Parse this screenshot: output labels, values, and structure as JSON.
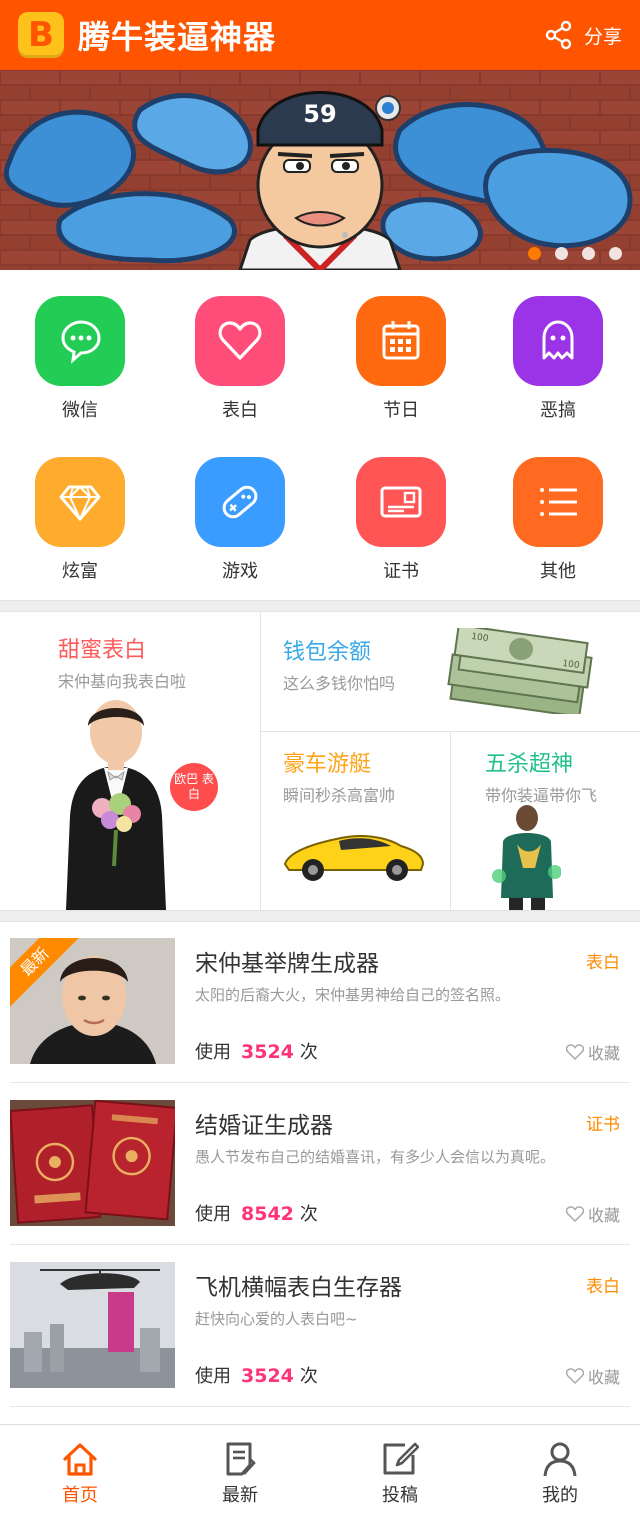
{
  "header": {
    "logo": "B",
    "title": "腾牛装逼神器",
    "share_label": "分享",
    "bg_color": "#ff5500"
  },
  "banner": {
    "slide_count": 4,
    "active_slide": 1,
    "cap_text": "59"
  },
  "categories": [
    {
      "label": "微信",
      "icon": "chat-icon",
      "color": "#22cc55"
    },
    {
      "label": "表白",
      "icon": "heart-icon",
      "color": "#ff4d7a"
    },
    {
      "label": "节日",
      "icon": "calendar-icon",
      "color": "#ff6a10"
    },
    {
      "label": "恶搞",
      "icon": "ghost-icon",
      "color": "#9b33e6"
    },
    {
      "label": "炫富",
      "icon": "diamond-icon",
      "color": "#ffab2e"
    },
    {
      "label": "游戏",
      "icon": "gamepad-icon",
      "color": "#3a9cff"
    },
    {
      "label": "证书",
      "icon": "certificate-icon",
      "color": "#ff5555"
    },
    {
      "label": "其他",
      "icon": "list-icon",
      "color": "#ff6a20"
    }
  ],
  "features": {
    "sweet": {
      "title": "甜蜜表白",
      "subtitle": "宋仲基向我表白啦",
      "badge": "欧巴 表白",
      "color": "#ff5a5a"
    },
    "wallet": {
      "title": "钱包余额",
      "subtitle": "这么多钱你怕吗",
      "color": "#3aa8e8"
    },
    "car": {
      "title": "豪车游艇",
      "subtitle": "瞬间秒杀高富帅",
      "color": "#ffa31a"
    },
    "pentakill": {
      "title": "五杀超神",
      "subtitle": "带你装逼带你飞",
      "color": "#22c08a"
    }
  },
  "list": [
    {
      "title": "宋仲基举牌生成器",
      "tag": "表白",
      "desc": "太阳的后裔大火，宋仲基男神给自己的签名照。",
      "use_label": "使用",
      "count": "3524",
      "unit": "次",
      "fav": "收藏",
      "ribbon": "最新"
    },
    {
      "title": "结婚证生成器",
      "tag": "证书",
      "desc": "愚人节发布自己的结婚喜讯，有多少人会信以为真呢。",
      "use_label": "使用",
      "count": "8542",
      "unit": "次",
      "fav": "收藏",
      "ribbon": ""
    },
    {
      "title": "飞机横幅表白生存器",
      "tag": "表白",
      "desc": "赶快向心爱的人表白吧~",
      "use_label": "使用",
      "count": "3524",
      "unit": "次",
      "fav": "收藏",
      "ribbon": ""
    }
  ],
  "tabs": [
    {
      "label": "首页",
      "icon": "home-icon",
      "active": true
    },
    {
      "label": "最新",
      "icon": "document-icon",
      "active": false
    },
    {
      "label": "投稿",
      "icon": "edit-icon",
      "active": false
    },
    {
      "label": "我的",
      "icon": "user-icon",
      "active": false
    }
  ]
}
